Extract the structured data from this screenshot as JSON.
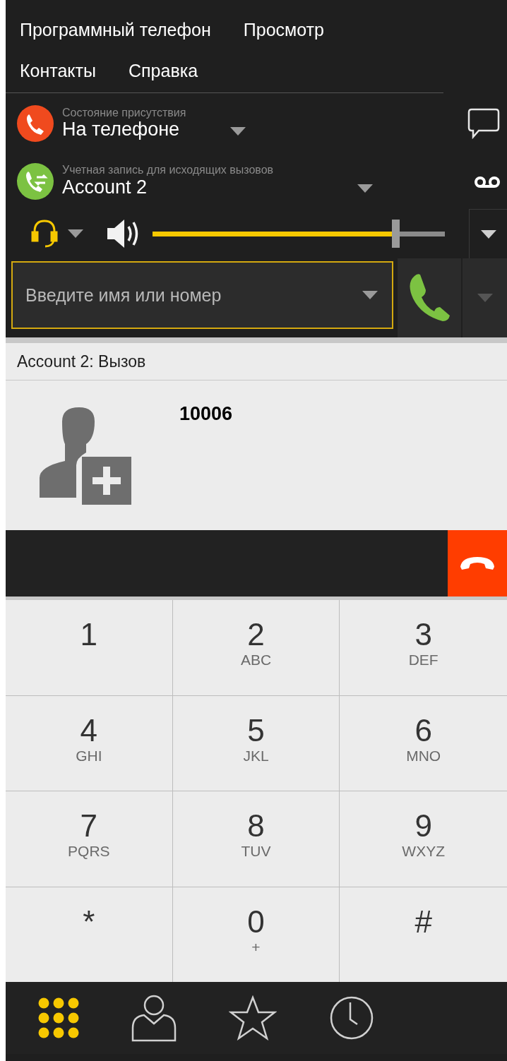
{
  "menu": [
    {
      "label": "Программный телефон"
    },
    {
      "label": "Просмотр"
    },
    {
      "label": "Контакты"
    },
    {
      "label": "Справка"
    }
  ],
  "presence": {
    "label": "Состояние присутствия",
    "value": "На телефоне"
  },
  "account": {
    "label": "Учетная запись для исходящих вызовов",
    "value": "Account 2"
  },
  "volume": {
    "level": 0.83
  },
  "dial": {
    "placeholder": "Введите имя или номер"
  },
  "call": {
    "header": "Account 2: Вызов",
    "number": "10006"
  },
  "keypad": [
    {
      "digit": "1"
    },
    {
      "digit": "2",
      "letters": "ABC"
    },
    {
      "digit": "3",
      "letters": "DEF"
    },
    {
      "digit": "4",
      "letters": "GHI"
    },
    {
      "digit": "5",
      "letters": "JKL"
    },
    {
      "digit": "6",
      "letters": "MNO"
    },
    {
      "digit": "7",
      "letters": "PQRS"
    },
    {
      "digit": "8",
      "letters": "TUV"
    },
    {
      "digit": "9",
      "letters": "WXYZ"
    },
    {
      "digit": "*"
    },
    {
      "digit": "0",
      "letters": "+"
    },
    {
      "digit": "#"
    }
  ],
  "nav": [
    {
      "kind": "keypad",
      "selected": true
    },
    {
      "kind": "contacts",
      "selected": false
    },
    {
      "kind": "favorites",
      "selected": false
    },
    {
      "kind": "history",
      "selected": false
    }
  ]
}
